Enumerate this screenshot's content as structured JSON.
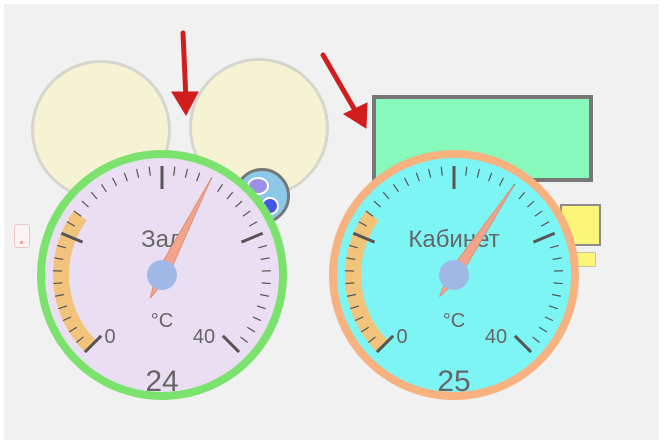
{
  "gauges": [
    {
      "id": "zal",
      "name": "Зал",
      "unit": "°C",
      "min_label": "0",
      "max_label": "40",
      "min": 0,
      "max": 40,
      "value": 24,
      "value_text": "24",
      "warning_band": [
        0,
        12
      ],
      "colors": {
        "rim": "#7be36d",
        "face": "#eadff2",
        "band": "#f2c37a",
        "needle": "#f2a58a",
        "hub": "#9fb8e6"
      }
    },
    {
      "id": "kabinet",
      "name": "Кабинет",
      "unit": "°C",
      "min_label": "0",
      "max_label": "40",
      "min": 0,
      "max": 40,
      "value": 25,
      "value_text": "25",
      "warning_band": [
        0,
        12
      ],
      "colors": {
        "rim": "#f7b27f",
        "face": "#7ef5f5",
        "band": "#f2c37a",
        "needle": "#f2a58a",
        "hub": "#9fb8e6"
      }
    }
  ],
  "colors": {
    "background": "#f1f1f1",
    "bubble": "#f5f3d2",
    "arrow": "#d21d1d",
    "green_box": "#86f9bb",
    "yellow_box": "#fbf57a"
  }
}
